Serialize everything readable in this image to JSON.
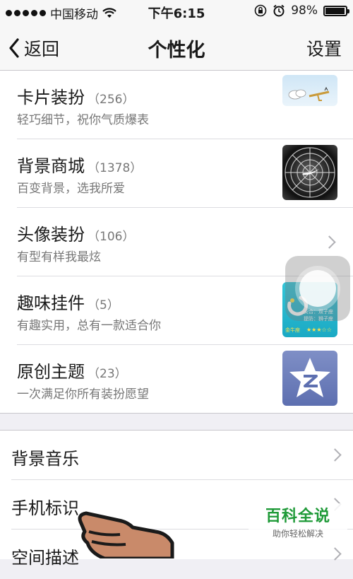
{
  "status_bar": {
    "carrier": "中国移动",
    "time": "下午6:15",
    "battery": "98%",
    "battery_level": 0.98
  },
  "nav": {
    "back_label": "返回",
    "title": "个性化",
    "right_label": "设置"
  },
  "items": [
    {
      "name": "卡片装扮",
      "count": "（256）",
      "desc": "轻巧细节，祝你气质爆表",
      "icon": "card-thumbnail"
    },
    {
      "name": "背景商城",
      "count": "（1378）",
      "desc": "百变背景，选我所爱",
      "icon": "flower-thumbnail"
    },
    {
      "name": "头像装扮",
      "count": "（106）",
      "desc": "有型有样我最炫",
      "icon": "chevron-right-icon"
    },
    {
      "name": "趣味挂件",
      "count": "（5）",
      "desc": "有趣实用，总有一款适合你",
      "icon": "widget-thumbnail",
      "widget_text": {
        "line1": "契合：双子座",
        "line2": "提防：狮子座",
        "line3": "金牛座"
      }
    },
    {
      "name": "原创主题",
      "count": "（23）",
      "desc": "一次满足你所有装扮愿望",
      "icon": "theme-thumbnail"
    }
  ],
  "rows": [
    {
      "label": "背景音乐"
    },
    {
      "label": "手机标识"
    },
    {
      "label": "空间描述"
    }
  ],
  "watermark": {
    "title": "百科全说",
    "subtitle": "助你轻松解决"
  }
}
